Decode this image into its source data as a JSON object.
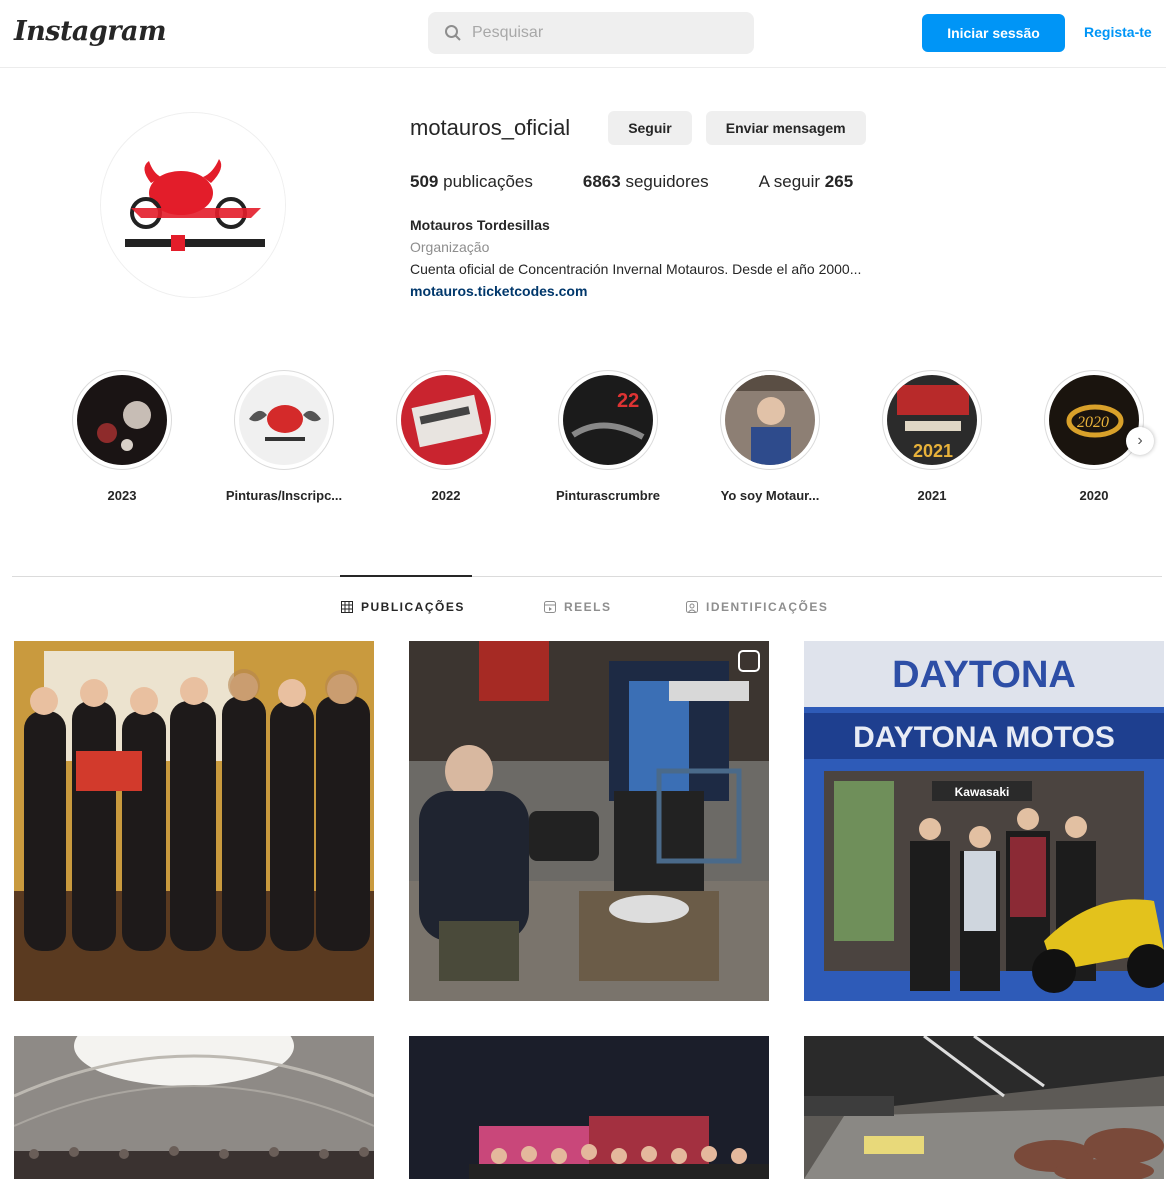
{
  "header": {
    "logo": "Instagram",
    "search_placeholder": "Pesquisar",
    "login_label": "Iniciar sessão",
    "register_label": "Regista-te"
  },
  "profile": {
    "username": "motauros_oficial",
    "follow_label": "Seguir",
    "message_label": "Enviar mensagem",
    "stats": {
      "posts_count": "509",
      "posts_label": "publicações",
      "followers_count": "6863",
      "followers_label": "seguidores",
      "following_label": "A seguir",
      "following_count": "265"
    },
    "bio": {
      "name": "Motauros Tordesillas",
      "category": "Organização",
      "text": "Cuenta oficial de Concentración Invernal Motauros. Desde el año 2000...",
      "link": "motauros.ticketcodes.com"
    }
  },
  "highlights": [
    {
      "label": "2023"
    },
    {
      "label": "Pinturas/Inscripc..."
    },
    {
      "label": "2022"
    },
    {
      "label": "Pinturascrumbre"
    },
    {
      "label": "Yo soy Motaur..."
    },
    {
      "label": "2021"
    },
    {
      "label": "2020"
    }
  ],
  "tabs": {
    "posts": "PUBLICAÇÕES",
    "reels": "REELS",
    "tagged": "IDENTIFICAÇÕES"
  },
  "posts": {
    "daytona_sign": "DAYTONA",
    "daytona_motos": "DAYTONA MOTOS",
    "kawasaki": "Kawasaki"
  },
  "colors": {
    "accent": "#0095f6",
    "link": "#00376b",
    "muted": "#8e8e8e"
  }
}
